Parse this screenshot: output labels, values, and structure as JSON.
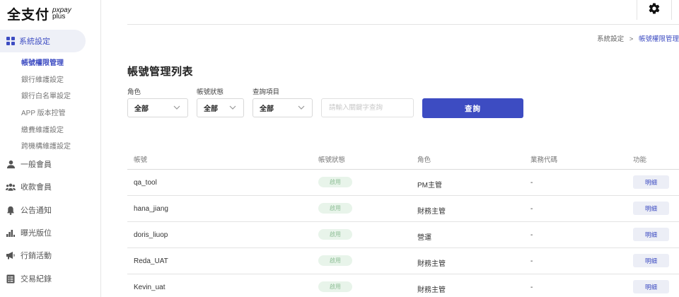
{
  "logo": {
    "cn": "全支付",
    "en_line1": "pxpay",
    "en_line2": "plus"
  },
  "sidebar": {
    "active_section": {
      "label": "系統設定",
      "icon": "grid-icon"
    },
    "sub_items": [
      {
        "label": "帳號權限管理",
        "active": true
      },
      {
        "label": "銀行維護設定",
        "active": false
      },
      {
        "label": "銀行白名單設定",
        "active": false
      },
      {
        "label": "APP 版本控管",
        "active": false
      },
      {
        "label": "繳費維護設定",
        "active": false
      },
      {
        "label": "跨機構維護設定",
        "active": false
      }
    ],
    "items": [
      {
        "label": "一般會員",
        "icon": "user-icon"
      },
      {
        "label": "收款會員",
        "icon": "users-group-icon"
      },
      {
        "label": "公告通知",
        "icon": "bell-icon"
      },
      {
        "label": "曝光版位",
        "icon": "bar-chart-icon"
      },
      {
        "label": "行銷活動",
        "icon": "megaphone-icon"
      },
      {
        "label": "交易紀錄",
        "icon": "list-document-icon"
      }
    ]
  },
  "header": {
    "settings_icon": "gear-icon"
  },
  "breadcrumb": {
    "parent": "系統設定",
    "separator": ">",
    "current": "帳號權限管理"
  },
  "page_title": "帳號管理列表",
  "filters": {
    "role": {
      "label": "角色",
      "value": "全部"
    },
    "status": {
      "label": "帳號狀態",
      "value": "全部"
    },
    "query_item": {
      "label": "查詢項目",
      "value": "全部"
    },
    "keyword": {
      "placeholder": "請輸入關鍵字查詢",
      "value": ""
    },
    "query_button": "查詢"
  },
  "table": {
    "columns": [
      "帳號",
      "帳號狀態",
      "角色",
      "業務代碼",
      "功能"
    ],
    "rows": [
      {
        "account": "qa_tool",
        "status": "啟用",
        "role": "PM主管",
        "business_code": "-",
        "action": "明細"
      },
      {
        "account": "hana_jiang",
        "status": "啟用",
        "role": "財務主管",
        "business_code": "-",
        "action": "明細"
      },
      {
        "account": "doris_liuop",
        "status": "啟用",
        "role": "營運",
        "business_code": "-",
        "action": "明細"
      },
      {
        "account": "Reda_UAT",
        "status": "啟用",
        "role": "財務主管",
        "business_code": "-",
        "action": "明細"
      },
      {
        "account": "Kevin_uat",
        "status": "啟用",
        "role": "財務主管",
        "business_code": "-",
        "action": "明細"
      }
    ]
  },
  "colors": {
    "accent": "#3d4cc2",
    "status_badge_bg": "#e8f4ea",
    "status_badge_text": "#8fbf97"
  }
}
